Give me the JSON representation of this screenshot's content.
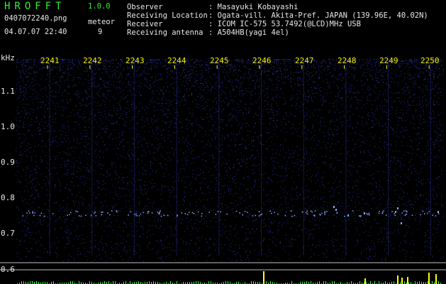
{
  "header": {
    "app_name": "HROFFT",
    "version": "1.0.0",
    "filename": "0407072240.png",
    "datetime": "04.07.07 22:40",
    "meteor_label": "meteor",
    "meteor_count": "9"
  },
  "info": {
    "rows": [
      {
        "key": "Observer",
        "value": ": Masayuki Kobayashi"
      },
      {
        "key": "Receiving Location",
        "value": ": Ogata-vill. Akita-Pref. JAPAN (139.96E, 40.02N)"
      },
      {
        "key": "Receiver",
        "value": ": ICOM IC-575 53.7492(@LCD)MHz USB"
      },
      {
        "key": "Receiving antenna",
        "value": ": A504HB(yagi 4el)"
      }
    ]
  },
  "spectrogram": {
    "y_unit": "kHz",
    "y_ticks": [
      "1.1",
      "1.0",
      "0.9",
      "0.8",
      "0.7",
      "0.6"
    ],
    "x_ticks": [
      "2241",
      "2242",
      "2243",
      "2244",
      "2245",
      "2246",
      "2247",
      "2248",
      "2249",
      "2250"
    ],
    "colors": {
      "background": "#000000",
      "noise": "#3840c8",
      "signal": "#88aaff",
      "grid": "#c0c0c0",
      "tick": "#ffff00",
      "meter": "#40ff40"
    }
  }
}
